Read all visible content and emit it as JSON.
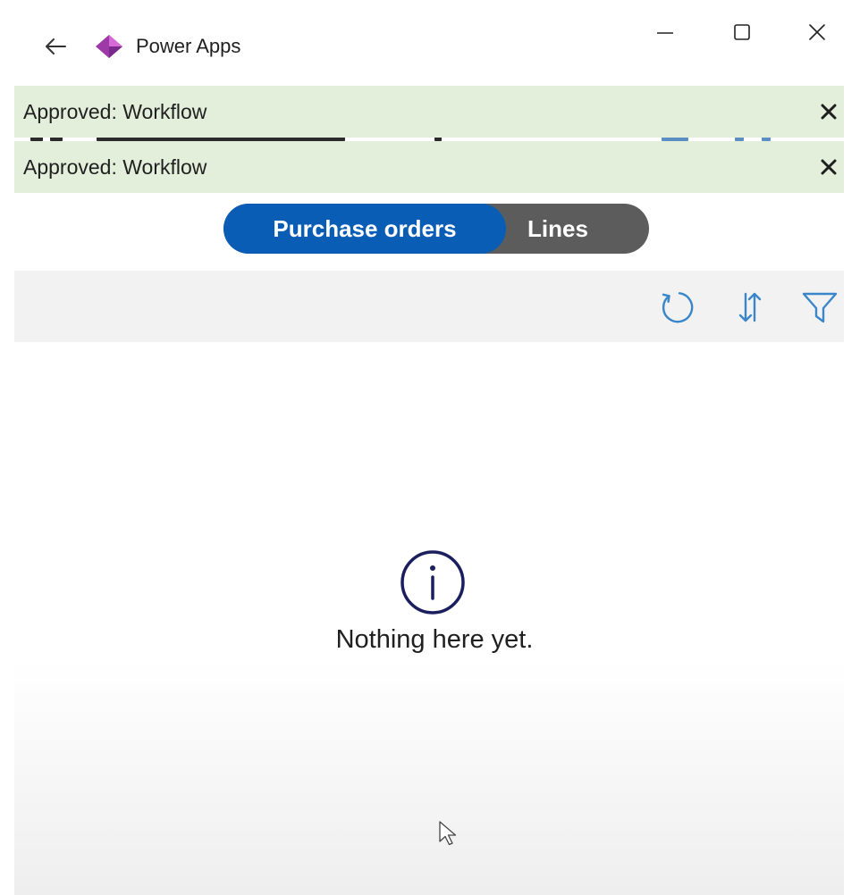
{
  "titlebar": {
    "app_name": "Power Apps",
    "back_icon": "arrow-left-icon",
    "logo_icon": "power-apps-logo",
    "controls": [
      "minimize-icon",
      "maximize-icon",
      "close-icon"
    ]
  },
  "notifications": [
    {
      "message": "Approved: Workflow",
      "close_icon": "close-icon"
    },
    {
      "message": "Approved: Workflow",
      "close_icon": "close-icon"
    }
  ],
  "tabs": {
    "items": [
      {
        "label": "Purchase orders",
        "selected": true
      },
      {
        "label": "Lines",
        "selected": false
      }
    ]
  },
  "toolbar": {
    "icons": [
      "refresh-icon",
      "sort-icon",
      "filter-icon"
    ]
  },
  "empty_state": {
    "icon": "info-icon",
    "message": "Nothing here yet."
  },
  "colors": {
    "accent_blue": "#0a5db5",
    "tab_inactive": "#5c5c5c",
    "banner_bg": "#e3efdb",
    "toolbar_bg": "#f2f2f2",
    "icon_blue": "#3a86c8",
    "info_icon_navy": "#1b1f5e"
  }
}
